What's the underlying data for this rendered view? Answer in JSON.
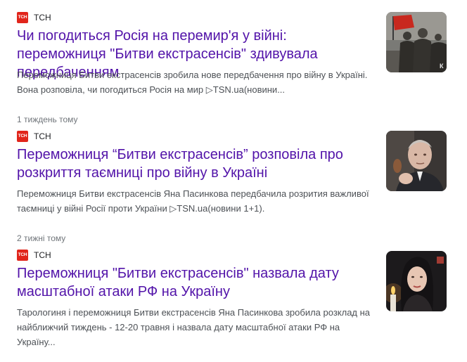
{
  "articles": [
    {
      "source": {
        "logo_text": "ТСН",
        "name": "ТСН"
      },
      "headline": "Чи погодиться Росія на перемир'я у війні: переможниця \"Битви екстрасенсів\" здивувала передбаченням",
      "snippet": "Переможниця Битви екстрасенсів зробила нове передбачення про війну в Україні. Вона розповіла, чи погодиться Росія на мир ▷TSN.ua(новини...",
      "age": "1 тиждень тому",
      "thumbnail_icon": "soldiers-photo"
    },
    {
      "source": {
        "logo_text": "ТСН",
        "name": "ТСН"
      },
      "headline": "Переможниця “Битви екстрасенсів” розповіла про розкриття таємниці про війну в Україні",
      "snippet": "Переможниця Битви екстрасенсів Яна Пасинкова передбачила розрития важливої таємниці у війні Росії проти України ▷TSN.ua(новини 1+1).",
      "age": "2 тижні тому",
      "thumbnail_icon": "man-portrait-photo"
    },
    {
      "source": {
        "logo_text": "ТСН",
        "name": "ТСН"
      },
      "headline": "Переможниця \"Битви екстрасенсів\" назвала дату масштабної атаки РФ на Україну",
      "snippet": "Тарологиня і переможниця Битви екстрасенсів Яна Пасинкова зробила розклад на найближчий тиждень - 12-20 травня і назвала дату масштабної атаки РФ на Україну...",
      "age": "",
      "thumbnail_icon": "woman-portrait-photo"
    }
  ],
  "colors": {
    "headline": "#5213a9",
    "snippet": "#4d5156",
    "meta": "#70757a",
    "logo_bg": "#e1251b"
  }
}
